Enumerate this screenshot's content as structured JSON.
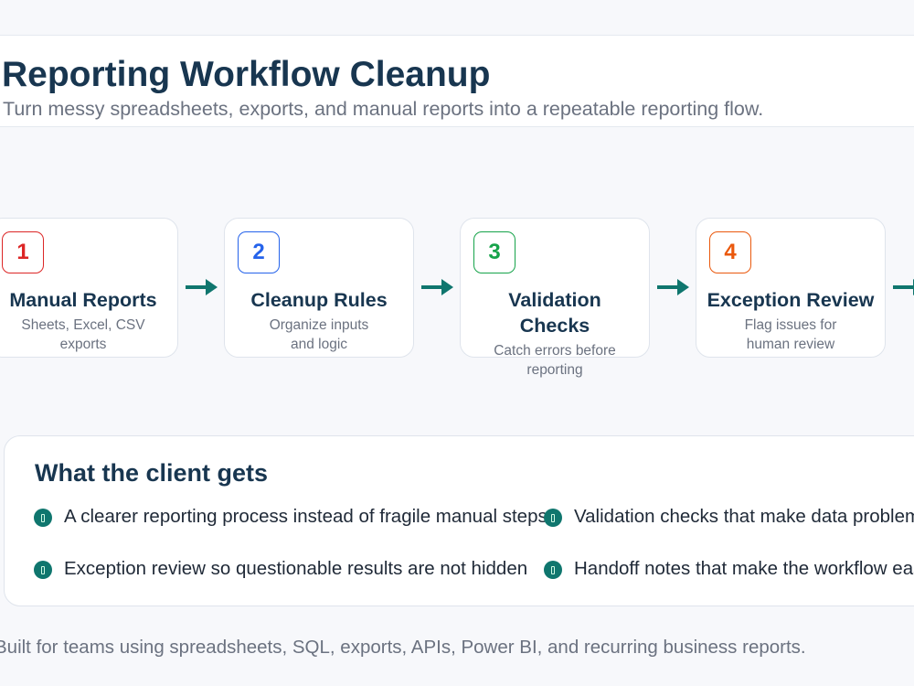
{
  "header": {
    "title": "Reporting Workflow Cleanup",
    "subtitle": "Turn messy spreadsheets, exports, and manual reports into a repeatable reporting flow."
  },
  "steps": [
    {
      "number": "1",
      "title": "Manual Reports",
      "description": "Sheets, Excel, CSV exports",
      "color": "#dc2626"
    },
    {
      "number": "2",
      "title": "Cleanup Rules",
      "description": "Organize inputs and logic",
      "color": "#2563eb"
    },
    {
      "number": "3",
      "title": "Validation Checks",
      "description": "Catch errors before reporting",
      "color": "#16a34a"
    },
    {
      "number": "4",
      "title": "Exception Review",
      "description": "Flag issues for human review",
      "color": "#ea580c"
    }
  ],
  "arrow_color": "#0f766e",
  "benefits": {
    "title": "What the client gets",
    "items": [
      {
        "text": "A clearer reporting process instead of fragile manual steps",
        "icon": "check-circle-icon"
      },
      {
        "text": "Validation checks that make data problems visible",
        "icon": "check-circle-icon"
      },
      {
        "text": "Exception review so questionable results are not hidden",
        "icon": "check-circle-icon"
      },
      {
        "text": "Handoff notes that make the workflow easier to maintain",
        "icon": "check-circle-icon"
      }
    ]
  },
  "footer": {
    "text": "Built for teams using spreadsheets, SQL, exports, APIs, Power BI, and recurring business reports."
  }
}
